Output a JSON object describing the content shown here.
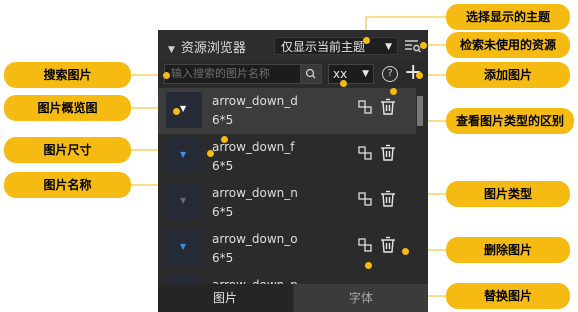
{
  "panel": {
    "title": "资源浏览器",
    "filter_value": "仅显示当前主题",
    "search_placeholder": "输入搜索的图片名称",
    "type_value": "xx",
    "help_glyph": "?",
    "items": [
      {
        "name": "arrow_down_d",
        "size": "6*5",
        "selected": true,
        "thumb_color": "#ffffff"
      },
      {
        "name": "arrow_down_f",
        "size": "6*5",
        "selected": false,
        "thumb_color": "#3d8fe6"
      },
      {
        "name": "arrow_down_n",
        "size": "6*5",
        "selected": false,
        "thumb_color": "#666a78"
      },
      {
        "name": "arrow_down_o",
        "size": "6*5",
        "selected": false,
        "thumb_color": "#3d8fe6"
      },
      {
        "name": "arrow_down_p",
        "size": "",
        "selected": false,
        "thumb_color": "#666a78"
      }
    ],
    "tabs": [
      "图片",
      "字体"
    ]
  },
  "callouts": {
    "select_theme": "选择显示的主题",
    "search_unused": "检索未使用的资源",
    "add_image": "添加图片",
    "type_difference": "查看图片类型的区别",
    "image_type": "图片类型",
    "delete_image": "删除图片",
    "replace_image": "替换图片",
    "search_image": "搜索图片",
    "preview": "图片概览图",
    "image_size": "图片尺寸",
    "image_name": "图片名称"
  },
  "colors": {
    "accent": "#f6bb12",
    "panel_bg": "#2b2b2b",
    "selected_row": "#3c3c3c"
  }
}
